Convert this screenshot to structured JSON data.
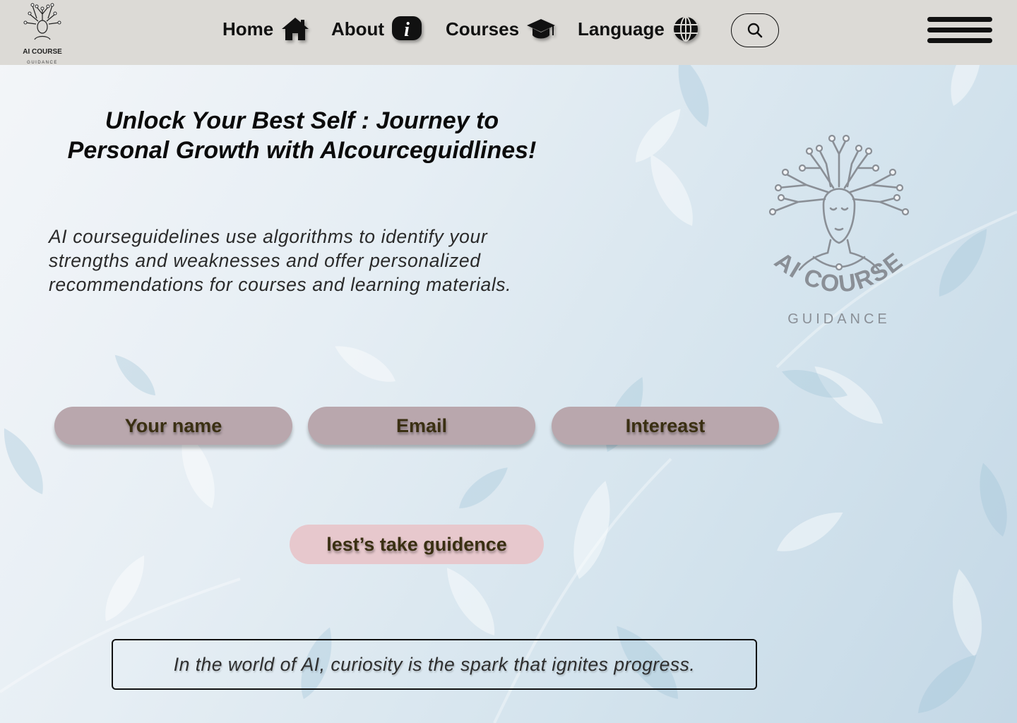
{
  "nav": {
    "logo": {
      "line1": "AI COURSE",
      "line2": "GUIDANCE"
    },
    "items": [
      {
        "label": "Home",
        "icon": "home-icon"
      },
      {
        "label": "About",
        "icon": "info-icon"
      },
      {
        "label": "Courses",
        "icon": "graduation-cap-icon"
      },
      {
        "label": "Language",
        "icon": "globe-icon"
      }
    ],
    "search_icon": "search-icon",
    "menu_icon": "hamburger-menu-icon"
  },
  "hero": {
    "headline_line1": "Unlock Your Best Self : Journey to",
    "headline_line2": "Personal Growth with AIcourceguidlines!",
    "description": "AI courseguidelines use algorithms to identify your strengths and weaknesses and offer personalized recommendations for courses and learning materials.",
    "logo": {
      "line1": "AI COURSE",
      "line2": "GUIDANCE"
    }
  },
  "form": {
    "name_placeholder": "Your name",
    "email_placeholder": "Email",
    "interest_placeholder": "Intereast",
    "submit_label": "lest’s take guidence"
  },
  "quote": "In the world of AI, curiosity is the spark that ignites progress.",
  "colors": {
    "navbar_bg": "#dcdad6",
    "field_bg": "#b9a7ad",
    "cta_bg": "#e7c8cd",
    "field_text": "#3a2f12",
    "logo_gray": "#8a8f96"
  }
}
